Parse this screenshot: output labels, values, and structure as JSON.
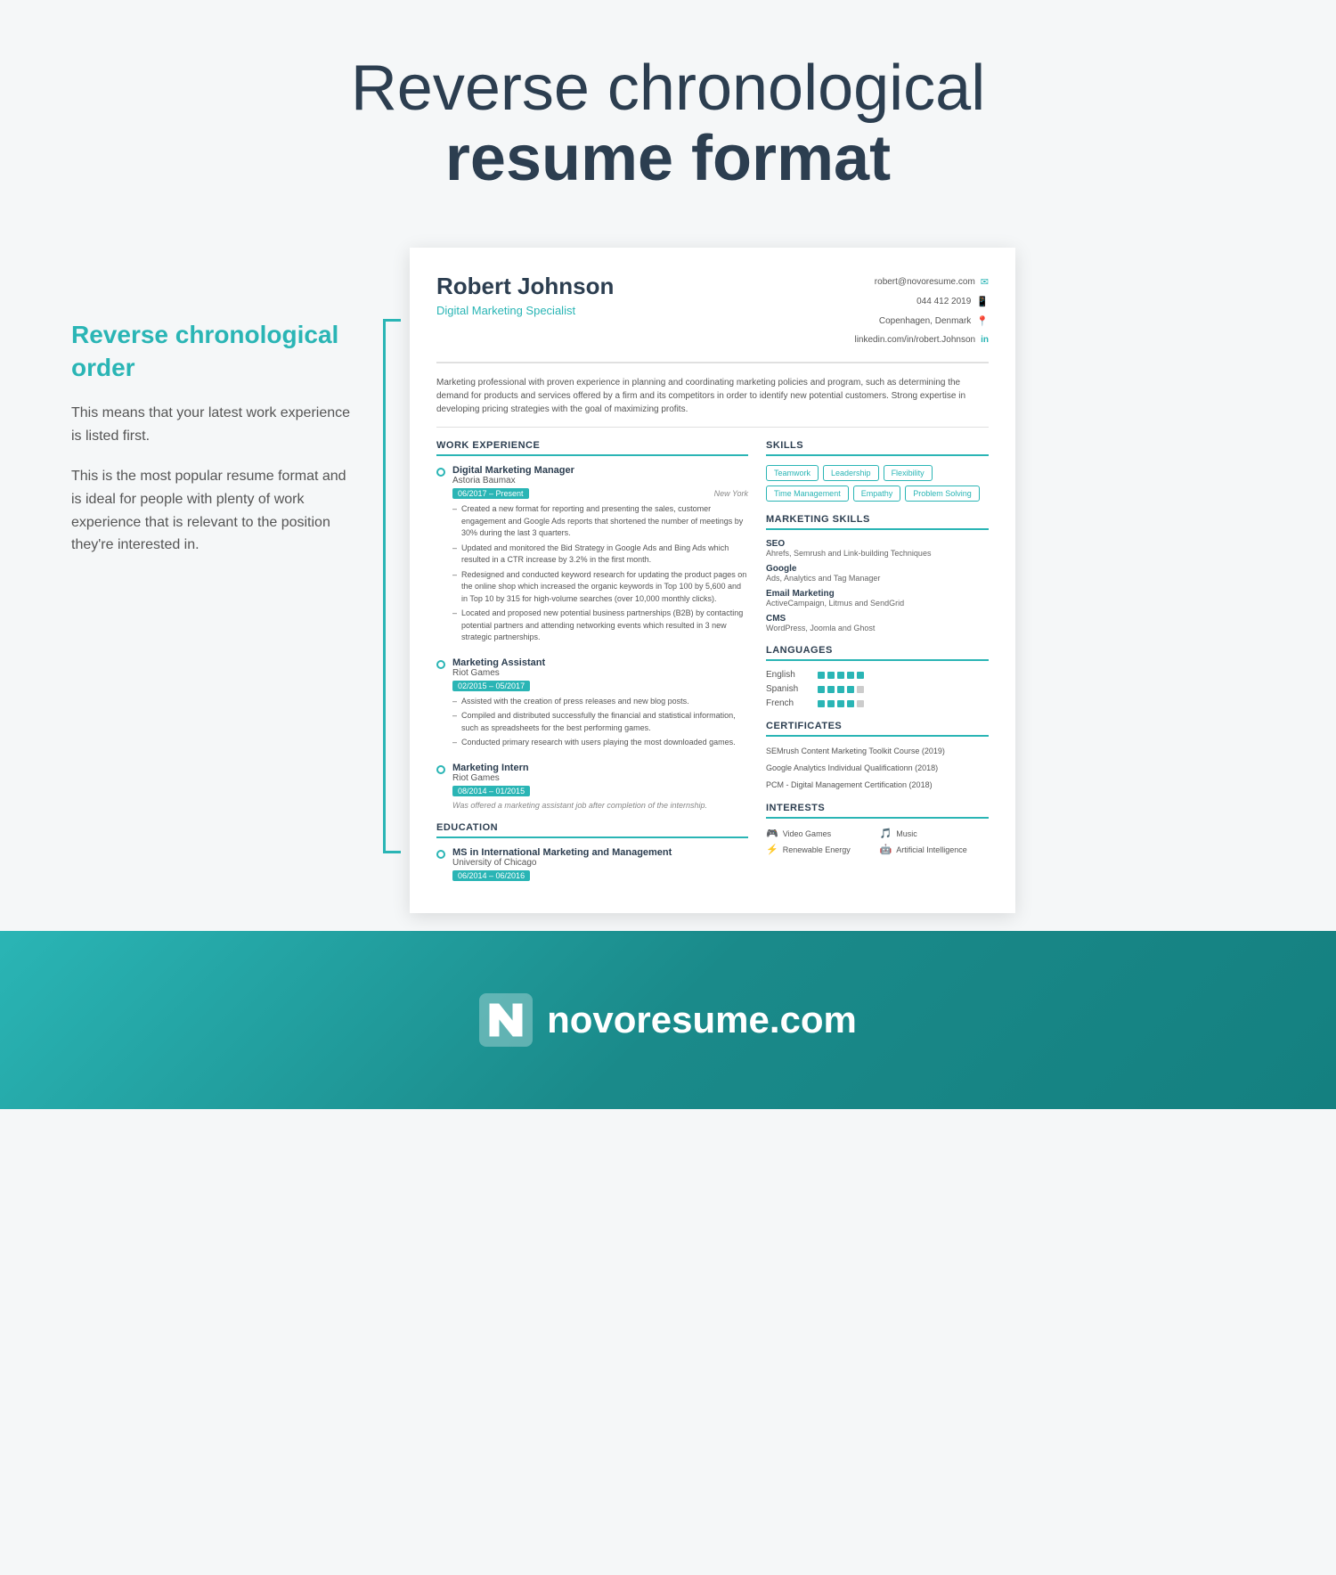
{
  "page": {
    "title_light": "Reverse chronological",
    "title_bold": "resume format"
  },
  "sidebar": {
    "heading": "Reverse chronological order",
    "text1": "This means that your latest work experience is listed first.",
    "text2": "This is the most popular resume format and is ideal for people with plenty of work experience that is relevant to the position they're interested in."
  },
  "resume": {
    "name": "Robert Johnson",
    "title": "Digital Marketing Specialist",
    "contact": {
      "email": "robert@novoresume.com",
      "phone": "044 412 2019",
      "location": "Copenhagen, Denmark",
      "linkedin": "linkedin.com/in/robert.Johnson"
    },
    "summary": "Marketing professional with proven experience in planning and coordinating marketing policies and program, such as determining the demand for products and services offered by a firm and its competitors in order to identify new potential customers. Strong expertise in developing pricing strategies with the goal of maximizing profits.",
    "work_experience_label": "WORK EXPERIENCE",
    "jobs": [
      {
        "title": "Digital Marketing Manager",
        "company": "Astoria Baumax",
        "date": "06/2017 – Present",
        "location": "New York",
        "bullets": [
          "Created a new format for reporting and presenting the sales, customer engagement and Google Ads reports that shortened the number of meetings by 30% during the last 3 quarters.",
          "Updated and monitored the Bid Strategy in Google Ads and Bing Ads which resulted in a CTR increase by 3.2% in the first month.",
          "Redesigned and conducted keyword research for updating the product pages on the online shop which increased the organic keywords in Top 100 by 5,600 and in Top 10 by 315 for high-volume searches (over 10,000 monthly clicks).",
          "Located and proposed new potential business partnerships (B2B) by contacting potential partners and attending networking events which resulted in 3 new strategic partnerships."
        ]
      },
      {
        "title": "Marketing Assistant",
        "company": "Riot Games",
        "date": "02/2015 – 05/2017",
        "location": "",
        "bullets": [
          "Assisted with the creation of press releases and new blog posts.",
          "Compiled and distributed successfully the financial and statistical information, such as spreadsheets for the best performing games.",
          "Conducted primary research with users playing the most downloaded games."
        ]
      },
      {
        "title": "Marketing Intern",
        "company": "Riot Games",
        "date": "08/2014 – 01/2015",
        "location": "",
        "note": "Was offered a marketing assistant job after completion of the internship.",
        "bullets": []
      }
    ],
    "education_label": "EDUCATION",
    "education": [
      {
        "degree": "MS in International Marketing and Management",
        "school": "University of Chicago",
        "date": "06/2014 – 06/2016"
      }
    ],
    "skills_label": "SKILLS",
    "skills": [
      "Teamwork",
      "Leadership",
      "Flexibility",
      "Time Management",
      "Empathy",
      "Problem Solving"
    ],
    "marketing_skills_label": "MARKETING SKILLS",
    "marketing_skills": [
      {
        "title": "SEO",
        "detail": "Ahrefs, Semrush and Link-building Techniques"
      },
      {
        "title": "Google",
        "detail": "Ads, Analytics and Tag Manager"
      },
      {
        "title": "Email Marketing",
        "detail": "ActiveCampaign, Litmus and SendGrid"
      },
      {
        "title": "CMS",
        "detail": "WordPress, Joomla and Ghost"
      }
    ],
    "languages_label": "LANGUAGES",
    "languages": [
      {
        "name": "English",
        "dots": 5
      },
      {
        "name": "Spanish",
        "dots": 4
      },
      {
        "name": "French",
        "dots": 4
      }
    ],
    "certificates_label": "CERTIFICATES",
    "certificates": [
      "SEMrush Content Marketing Toolkit Course (2019)",
      "Google Analytics Individual Qualificationn (2018)",
      "PCM - Digital Management Certification (2018)"
    ],
    "interests_label": "INTERESTS",
    "interests": [
      {
        "icon": "🎮",
        "label": "Video Games"
      },
      {
        "icon": "🎵",
        "label": "Music"
      },
      {
        "icon": "⚡",
        "label": "Renewable Energy"
      },
      {
        "icon": "🤖",
        "label": "Artificial Intelligence"
      }
    ]
  },
  "footer": {
    "brand": "novoresume.com"
  }
}
